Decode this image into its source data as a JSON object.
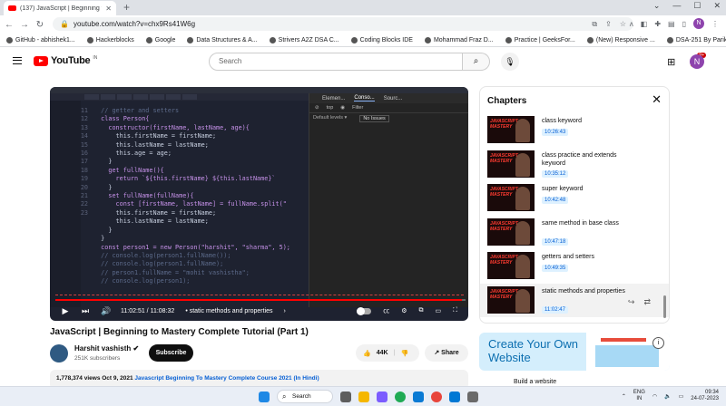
{
  "browser": {
    "tab_title": "(137) JavaScript | Beginning to M",
    "url": "youtube.com/watch?v=chx9Rs41W6g",
    "bookmarks": [
      "GitHub - abhishek1...",
      "Hackerblocks",
      "Google",
      "Data Structures & A...",
      "Strivers A2Z DSA C...",
      "Coding Blocks IDE",
      "Mohammad Fraz D...",
      "Practice | GeeksFor...",
      "(New) Responsive ...",
      "DSA-251 By Parikh..."
    ],
    "profile_initial": "N"
  },
  "header": {
    "logo_text": "YouTube",
    "logo_region": "IN",
    "search_placeholder": "Search",
    "notif_count": "9+",
    "avatar_initial": "N"
  },
  "video": {
    "time_current": "11:02:51",
    "time_total": "11:08:32",
    "chapter_label": "• static methods and properties",
    "progress_fraction": 0.991,
    "code_lines": [
      {
        "n": "",
        "t": "  // getter and setters"
      },
      {
        "n": "",
        "t": "  class Person{"
      },
      {
        "n": "",
        "t": "    constructor(firstName, lastName, age){"
      },
      {
        "n": "",
        "t": "      this.firstName = firstName;"
      },
      {
        "n": "",
        "t": "      this.lastName = lastName;"
      },
      {
        "n": "",
        "t": "      this.age = age;"
      },
      {
        "n": "",
        "t": "    }"
      },
      {
        "n": "",
        "t": "    get fullName(){"
      },
      {
        "n": "",
        "t": "      return `${this.firstName} ${this.lastName}`"
      },
      {
        "n": "",
        "t": "    }"
      },
      {
        "n": "11",
        "t": "    set fullName(fullName){"
      },
      {
        "n": "12",
        "t": "      const [firstName, lastName] = fullName.split(\""
      },
      {
        "n": "13",
        "t": "      this.firstName = firstName;"
      },
      {
        "n": "14",
        "t": "      this.lastName = lastName;"
      },
      {
        "n": "15",
        "t": "    }"
      },
      {
        "n": "16",
        "t": "  }"
      },
      {
        "n": "17",
        "t": ""
      },
      {
        "n": "18",
        "t": ""
      },
      {
        "n": "19",
        "t": "  const person1 = new Person(\"harshit\", \"sharma\", 5);"
      },
      {
        "n": "20",
        "t": "  // console.log(person1.fullName());"
      },
      {
        "n": "21",
        "t": "  // console.log(person1.fullName);"
      },
      {
        "n": "22",
        "t": "  // person1.fullName = \"mohit vashistha\";"
      },
      {
        "n": "23",
        "t": "  // console.log(person1);"
      }
    ],
    "devtools": {
      "tabs": [
        "Elemen...",
        "Conso...",
        "Sourc..."
      ],
      "active_tab": "Conso...",
      "toolbar": [
        "top",
        "Filter"
      ],
      "levels_label": "Default levels ▾",
      "issues_label": "No Issues"
    }
  },
  "below": {
    "title": "JavaScript | Beginning to Mastery Complete Tutorial (Part 1)",
    "channel": "Harshit vashisth",
    "subscribers": "251K subscribers",
    "subscribe_label": "Subscribe",
    "likes": "44K",
    "share_label": "Share",
    "views_date": "1,778,374 views  Oct 9, 2021",
    "desc_link": "Javascript Beginning To Mastery Complete Course 2021 (In Hindi)"
  },
  "chapters": {
    "heading": "Chapters",
    "thumb_text": "JAVASCRIPT\nMASTERY",
    "items": [
      {
        "title": "class keyword",
        "time": "10:26:43"
      },
      {
        "title": "class practice and extends keyword",
        "time": "10:35:12"
      },
      {
        "title": "super keyword",
        "time": "10:42:48"
      },
      {
        "title": "same method in base class",
        "time": "10:47:18"
      },
      {
        "title": "getters and setters",
        "time": "10:49:35"
      },
      {
        "title": "static methods and properties",
        "time": "11:02:47"
      }
    ],
    "active_index": 5
  },
  "ad": {
    "text": "Create Your Own Website",
    "next_label": "Build a website"
  },
  "taskbar": {
    "search_label": "Search",
    "lang_1": "ENG",
    "lang_2": "IN",
    "time": "09:34",
    "date": "24-07-2023"
  }
}
